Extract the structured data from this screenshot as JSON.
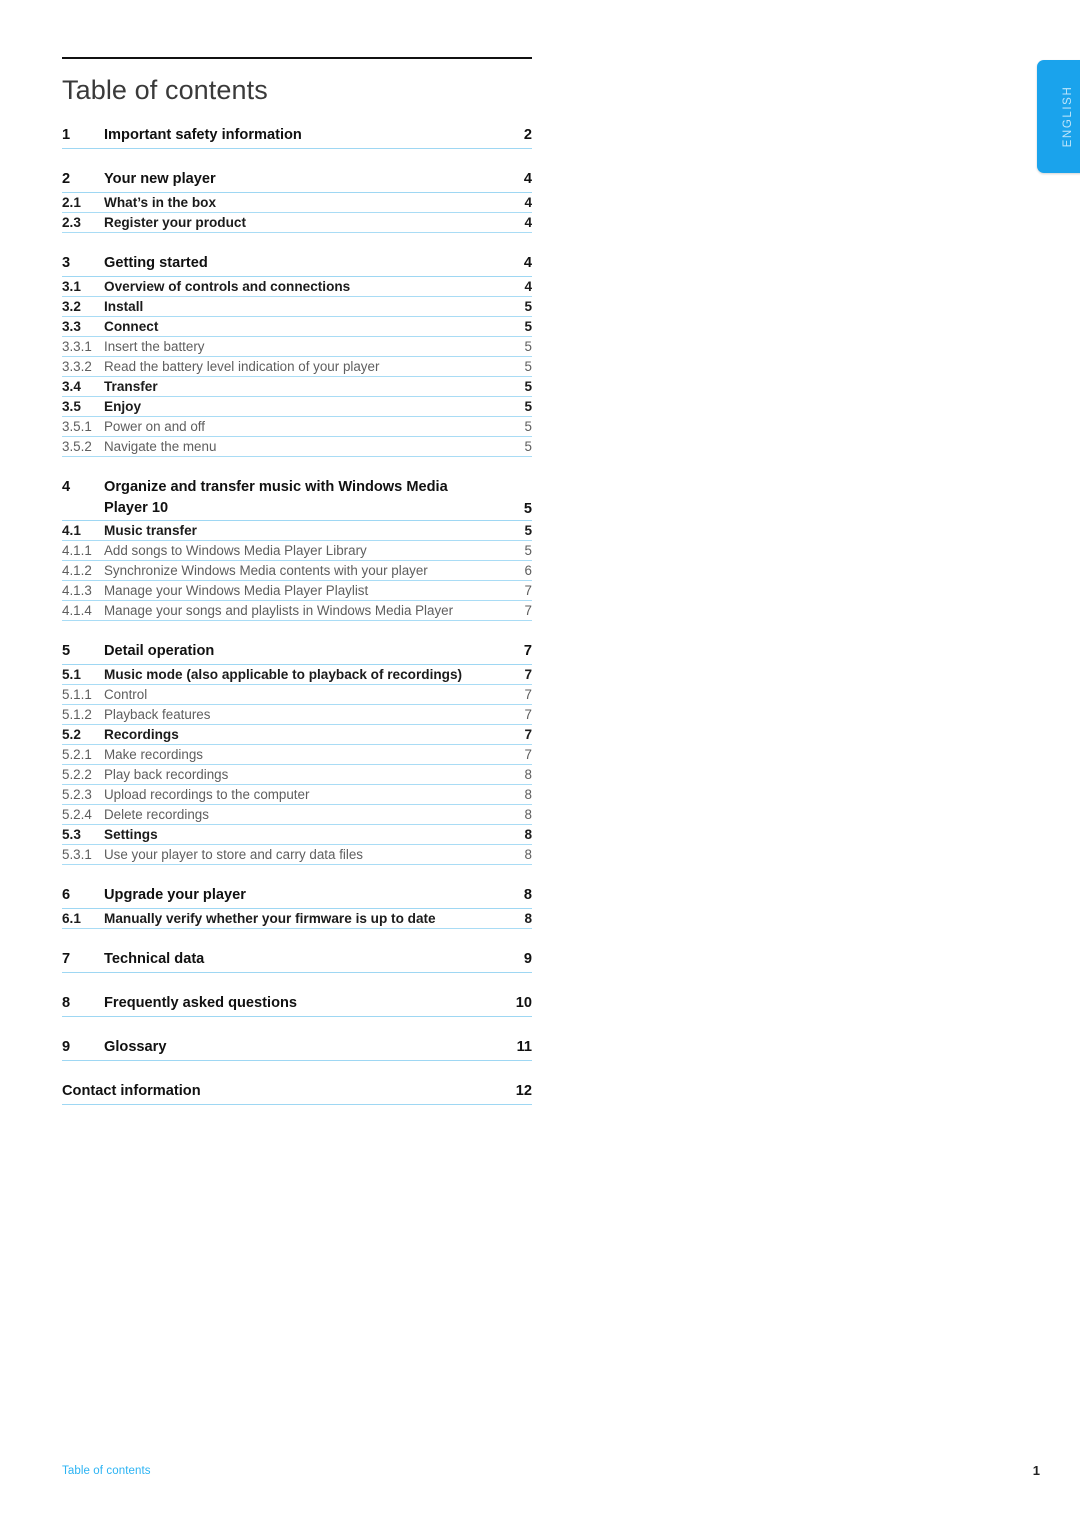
{
  "language_tab": {
    "label": "ENGLISH",
    "color": "#1aa3ec",
    "text_color": "#bfe6fb"
  },
  "header": {
    "title": "Table of contents"
  },
  "colors": {
    "rule": "#111111",
    "separator": "#a9dcf5",
    "accent": "#2bb3f3"
  },
  "toc": {
    "entries": [
      {
        "level": 1,
        "number": "1",
        "title": "Important safety information",
        "page": "2",
        "gap": false
      },
      {
        "level": 1,
        "number": "2",
        "title": "Your new player",
        "page": "4",
        "gap": true
      },
      {
        "level": 2,
        "number": "2.1",
        "title": "What’s in the box",
        "page": "4",
        "gap": false
      },
      {
        "level": 2,
        "number": "2.3",
        "title": "Register your product",
        "page": "4",
        "gap": false
      },
      {
        "level": 1,
        "number": "3",
        "title": "Getting started",
        "page": "4",
        "gap": true
      },
      {
        "level": 2,
        "number": "3.1",
        "title": "Overview of controls and connections",
        "page": "4",
        "gap": false
      },
      {
        "level": 2,
        "number": "3.2",
        "title": "Install",
        "page": "5",
        "gap": false
      },
      {
        "level": 2,
        "number": "3.3",
        "title": "Connect",
        "page": "5",
        "gap": false
      },
      {
        "level": 3,
        "number": "3.3.1",
        "title": "Insert the battery",
        "page": "5",
        "gap": false
      },
      {
        "level": 3,
        "number": "3.3.2",
        "title": "Read the battery level indication of your player",
        "page": "5",
        "gap": false
      },
      {
        "level": 2,
        "number": "3.4",
        "title": "Transfer",
        "page": "5",
        "gap": false
      },
      {
        "level": 2,
        "number": "3.5",
        "title": "Enjoy",
        "page": "5",
        "gap": false
      },
      {
        "level": 3,
        "number": "3.5.1",
        "title": "Power on and off",
        "page": "5",
        "gap": false
      },
      {
        "level": 3,
        "number": "3.5.2",
        "title": "Navigate the menu",
        "page": "5",
        "gap": false
      },
      {
        "level": 1,
        "number": "4",
        "title": "Organize and transfer music with Windows Media Player 10",
        "page": "5",
        "gap": true,
        "two_line": true
      },
      {
        "level": 2,
        "number": "4.1",
        "title": "Music transfer",
        "page": "5",
        "gap": false
      },
      {
        "level": 3,
        "number": "4.1.1",
        "title": "Add songs to Windows Media Player Library",
        "page": "5",
        "gap": false
      },
      {
        "level": 3,
        "number": "4.1.2",
        "title": "Synchronize Windows Media contents with your player",
        "page": "6",
        "gap": false
      },
      {
        "level": 3,
        "number": "4.1.3",
        "title": "Manage your Windows Media Player Playlist",
        "page": "7",
        "gap": false
      },
      {
        "level": 3,
        "number": "4.1.4",
        "title": "Manage your songs and playlists in Windows Media Player",
        "page": "7",
        "gap": false
      },
      {
        "level": 1,
        "number": "5",
        "title": "Detail operation",
        "page": "7",
        "gap": true
      },
      {
        "level": 2,
        "number": "5.1",
        "title": "Music mode (also applicable to playback of recordings)",
        "page": "7",
        "gap": false
      },
      {
        "level": 3,
        "number": "5.1.1",
        "title": "Control",
        "page": "7",
        "gap": false
      },
      {
        "level": 3,
        "number": "5.1.2",
        "title": "Playback features",
        "page": "7",
        "gap": false
      },
      {
        "level": 2,
        "number": "5.2",
        "title": "Recordings",
        "page": "7",
        "gap": false
      },
      {
        "level": 3,
        "number": "5.2.1",
        "title": "Make recordings",
        "page": "7",
        "gap": false
      },
      {
        "level": 3,
        "number": "5.2.2",
        "title": "Play back recordings",
        "page": "8",
        "gap": false
      },
      {
        "level": 3,
        "number": "5.2.3",
        "title": "Upload recordings to the computer",
        "page": "8",
        "gap": false
      },
      {
        "level": 3,
        "number": "5.2.4",
        "title": "Delete recordings",
        "page": "8",
        "gap": false
      },
      {
        "level": 2,
        "number": "5.3",
        "title": "Settings",
        "page": "8",
        "gap": false
      },
      {
        "level": 3,
        "number": "5.3.1",
        "title": "Use your player to store and carry data files",
        "page": "8",
        "gap": false
      },
      {
        "level": 1,
        "number": "6",
        "title": "Upgrade your player",
        "page": "8",
        "gap": true
      },
      {
        "level": 2,
        "number": "6.1",
        "title": "Manually verify whether your firmware is up to date",
        "page": "8",
        "gap": false
      },
      {
        "level": 1,
        "number": "7",
        "title": "Technical data",
        "page": "9",
        "gap": true
      },
      {
        "level": 1,
        "number": "8",
        "title": "Frequently asked questions",
        "page": "10",
        "gap": true
      },
      {
        "level": 1,
        "number": "9",
        "title": "Glossary",
        "page": "11",
        "gap": true
      },
      {
        "level": 1,
        "number": "",
        "title": "Contact information",
        "page": "12",
        "gap": true,
        "unnumbered": true
      }
    ]
  },
  "footer": {
    "left_text": "Table of contents",
    "page_number": "1"
  }
}
